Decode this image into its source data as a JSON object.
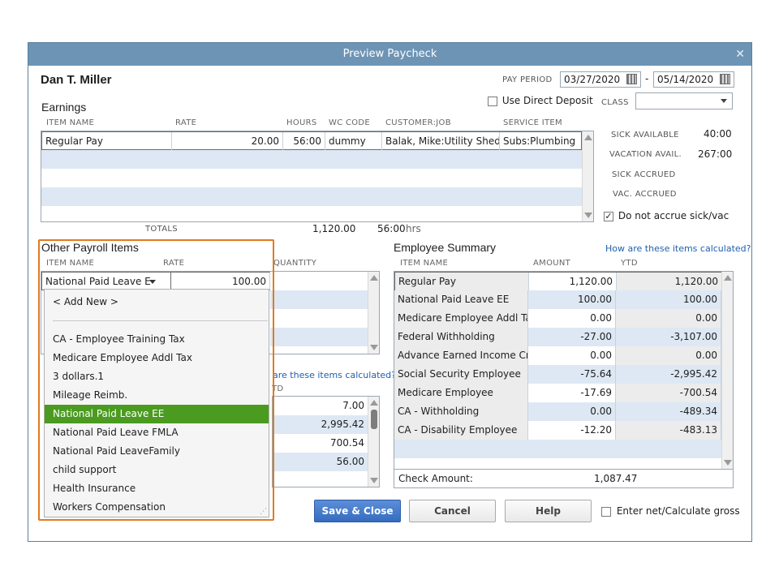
{
  "window": {
    "title": "Preview Paycheck"
  },
  "employee": {
    "name": "Dan T. Miller"
  },
  "pay_period": {
    "label": "PAY PERIOD",
    "start": "03/27/2020",
    "dash": "-",
    "end": "05/14/2020"
  },
  "direct_deposit": {
    "label": "Use Direct Deposit",
    "checked": false
  },
  "class": {
    "label": "CLASS",
    "value": ""
  },
  "earnings": {
    "title": "Earnings",
    "columns": [
      "ITEM NAME",
      "RATE",
      "HOURS",
      "WC CODE",
      "CUSTOMER:JOB",
      "SERVICE ITEM"
    ],
    "rows": [
      {
        "item": "Regular Pay",
        "rate": "20.00",
        "hours": "56:00",
        "wc": "dummy",
        "job": "Balak, Mike:Utility Shed",
        "service": "Subs:Plumbing"
      }
    ],
    "totals_label": "TOTALS",
    "total_amount": "1,120.00",
    "total_hours": "56:00",
    "hrs_unit": "hrs"
  },
  "accruals": {
    "sick_available_label": "SICK AVAILABLE",
    "sick_available": "40:00",
    "vacation_avail_label": "VACATION AVAIL.",
    "vacation_avail": "267:00",
    "sick_accrued_label": "SICK ACCRUED",
    "vac_accrued_label": "VAC. ACCRUED",
    "no_accrue_label": "Do not accrue sick/vac",
    "no_accrue_checked": true
  },
  "other_payroll": {
    "title": "Other Payroll Items",
    "columns": [
      "ITEM NAME",
      "RATE",
      "QUANTITY"
    ],
    "current": {
      "item": "National Paid Leave E",
      "rate": "100.00"
    },
    "dropdown": [
      "< Add New >",
      "CA - Employee Training Tax",
      "Medicare Employee Addl Tax",
      "3 dollars.1",
      "Mileage Reimb.",
      "National Paid Leave EE",
      "National Paid Leave FMLA",
      "National Paid LeaveFamily",
      "child support",
      "Health Insurance",
      "Workers Compensation"
    ],
    "selected_index": 5
  },
  "company_summary": {
    "link": "are these items calculated?",
    "ytd_header": "TD",
    "values": [
      "7.00",
      "2,995.42",
      "700.54",
      "56.00"
    ]
  },
  "employee_summary": {
    "title": "Employee Summary",
    "link": "How are these items calculated?",
    "columns": [
      "ITEM NAME",
      "AMOUNT",
      "YTD"
    ],
    "rows": [
      {
        "item": "Regular Pay",
        "amount": "1,120.00",
        "ytd": "1,120.00"
      },
      {
        "item": "National Paid Leave EE",
        "amount": "100.00",
        "ytd": "100.00"
      },
      {
        "item": "Medicare Employee Addl Tax",
        "amount": "0.00",
        "ytd": "0.00"
      },
      {
        "item": "Federal Withholding",
        "amount": "-27.00",
        "ytd": "-3,107.00"
      },
      {
        "item": "Advance Earned Income Cr...",
        "amount": "0.00",
        "ytd": "0.00"
      },
      {
        "item": "Social Security Employee",
        "amount": "-75.64",
        "ytd": "-2,995.42"
      },
      {
        "item": "Medicare Employee",
        "amount": "-17.69",
        "ytd": "-700.54"
      },
      {
        "item": "CA - Withholding",
        "amount": "0.00",
        "ytd": "-489.34"
      },
      {
        "item": "CA - Disability Employee",
        "amount": "-12.20",
        "ytd": "-483.13"
      }
    ],
    "check_amount_label": "Check Amount:",
    "check_amount": "1,087.47"
  },
  "buttons": {
    "save_close": "Save & Close",
    "cancel": "Cancel",
    "help": "Help"
  },
  "enter_net": {
    "label": "Enter net/Calculate gross",
    "checked": false
  },
  "colors": {
    "highlight": "#e07b1f",
    "selected": "#4a9b20",
    "primary": "#356cc0"
  }
}
